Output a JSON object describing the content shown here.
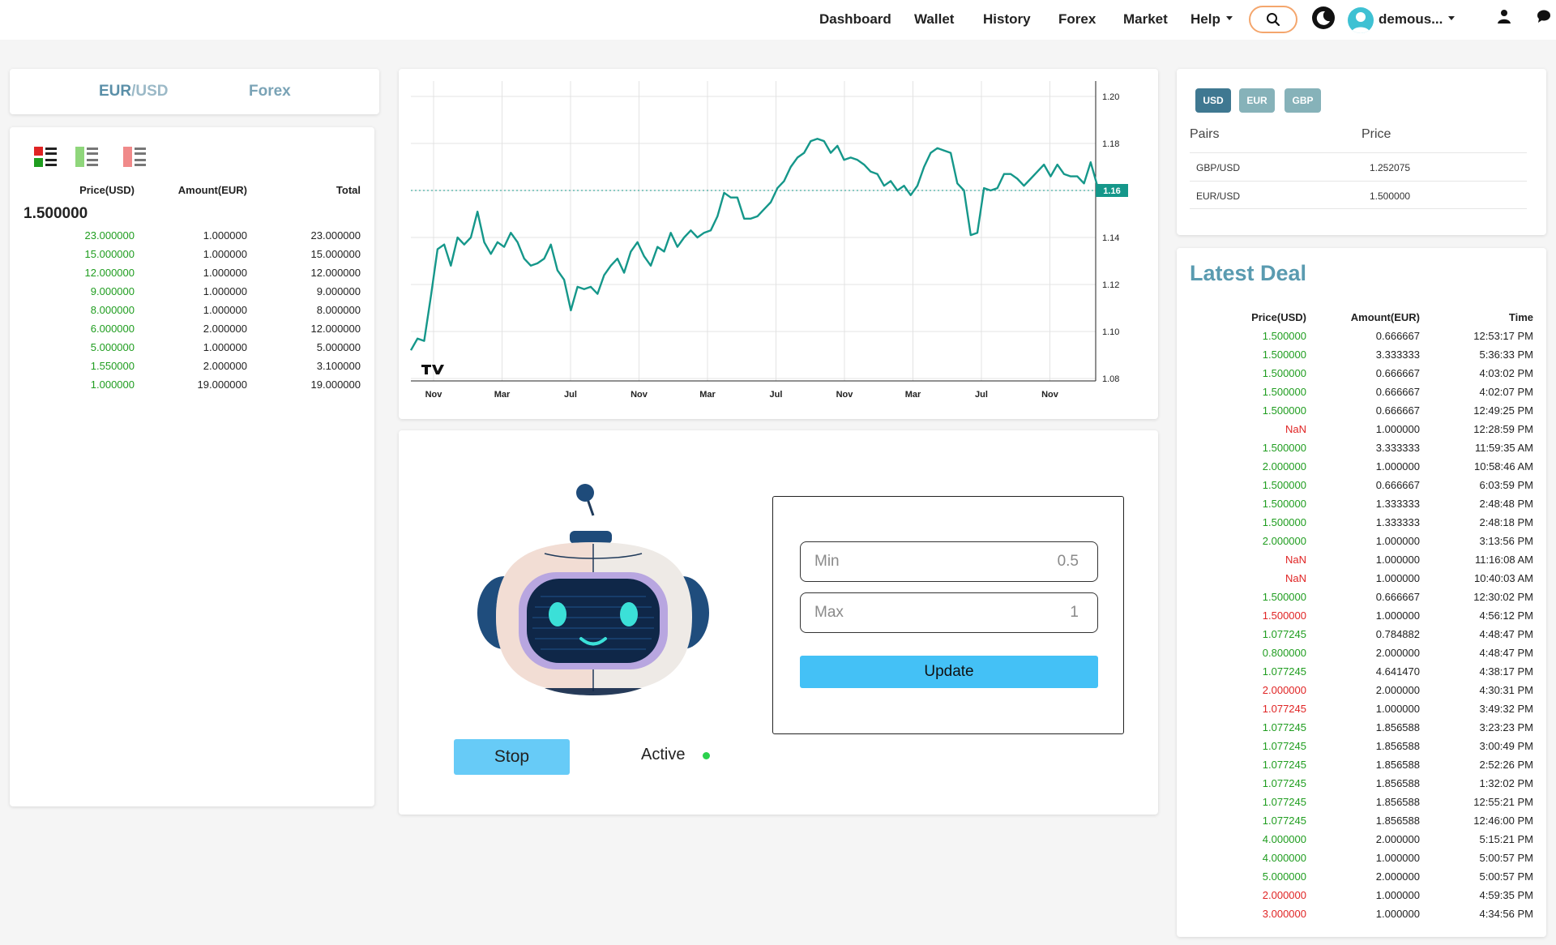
{
  "nav": {
    "links": [
      "Dashboard",
      "Wallet",
      "History",
      "Forex",
      "Market"
    ],
    "help": "Help",
    "username": "demous..."
  },
  "pair_tabs": {
    "pair_base": "EUR",
    "pair_sep": "/",
    "pair_quote": "USD",
    "market": "Forex"
  },
  "orderbook": {
    "headers": {
      "price": "Price(USD)",
      "amount": "Amount(EUR)",
      "total": "Total"
    },
    "last_price": "1.500000",
    "rows": [
      {
        "price": "23.000000",
        "amount": "1.000000",
        "total": "23.000000"
      },
      {
        "price": "15.000000",
        "amount": "1.000000",
        "total": "15.000000"
      },
      {
        "price": "12.000000",
        "amount": "1.000000",
        "total": "12.000000"
      },
      {
        "price": "9.000000",
        "amount": "1.000000",
        "total": "9.000000"
      },
      {
        "price": "8.000000",
        "amount": "1.000000",
        "total": "8.000000"
      },
      {
        "price": "6.000000",
        "amount": "2.000000",
        "total": "12.000000"
      },
      {
        "price": "5.000000",
        "amount": "1.000000",
        "total": "5.000000"
      },
      {
        "price": "1.550000",
        "amount": "2.000000",
        "total": "3.100000"
      },
      {
        "price": "1.000000",
        "amount": "19.000000",
        "total": "19.000000"
      }
    ]
  },
  "chart_data": {
    "type": "line",
    "x_ticks": [
      "Nov",
      "Mar",
      "Jul",
      "Nov",
      "Mar",
      "Jul",
      "Nov",
      "Mar",
      "Jul",
      "Nov"
    ],
    "y_ticks": [
      "1.20",
      "1.18",
      "1.16",
      "1.14",
      "1.12",
      "1.10",
      "1.08"
    ],
    "ylim": [
      1.08,
      1.2
    ],
    "current_value": 1.16,
    "current_label": "1.16",
    "line_color": "#15978a",
    "series": [
      {
        "values": [
          1.092,
          1.097,
          1.096,
          1.115,
          1.135,
          1.137,
          1.128,
          1.14,
          1.137,
          1.14,
          1.151,
          1.138,
          1.133,
          1.138,
          1.136,
          1.142,
          1.138,
          1.131,
          1.128,
          1.129,
          1.131,
          1.137,
          1.126,
          1.122,
          1.109,
          1.119,
          1.118,
          1.119,
          1.116,
          1.124,
          1.128,
          1.131,
          1.125,
          1.134,
          1.138,
          1.132,
          1.128,
          1.136,
          1.134,
          1.142,
          1.136,
          1.14,
          1.143,
          1.14,
          1.142,
          1.143,
          1.149,
          1.159,
          1.157,
          1.157,
          1.148,
          1.148,
          1.149,
          1.152,
          1.155,
          1.161,
          1.164,
          1.17,
          1.174,
          1.176,
          1.181,
          1.182,
          1.181,
          1.176,
          1.179,
          1.173,
          1.174,
          1.173,
          1.171,
          1.168,
          1.167,
          1.162,
          1.164,
          1.16,
          1.162,
          1.158,
          1.162,
          1.17,
          1.176,
          1.178,
          1.177,
          1.176,
          1.163,
          1.16,
          1.141,
          1.142,
          1.161,
          1.16,
          1.161,
          1.167,
          1.167,
          1.165,
          1.162,
          1.165,
          1.168,
          1.171,
          1.166,
          1.171,
          1.167,
          1.166,
          1.166,
          1.163,
          1.172,
          1.162
        ]
      }
    ]
  },
  "bot": {
    "stop_label": "Stop",
    "status_label": "Active",
    "min_label": "Min",
    "min_value": "0.5",
    "max_label": "Max",
    "max_value": "1",
    "update_label": "Update"
  },
  "prices": {
    "currencies": [
      "USD",
      "EUR",
      "GBP"
    ],
    "headers": {
      "pairs": "Pairs",
      "price": "Price"
    },
    "rows": [
      {
        "pair": "GBP/USD",
        "price": "1.252075"
      },
      {
        "pair": "EUR/USD",
        "price": "1.500000"
      }
    ]
  },
  "latest_deal": {
    "title": "Latest Deal",
    "headers": {
      "price": "Price(USD)",
      "amount": "Amount(EUR)",
      "time": "Time"
    },
    "rows": [
      {
        "price": "1.500000",
        "amount": "0.666667",
        "time": "12:53:17 PM",
        "dir": "up"
      },
      {
        "price": "1.500000",
        "amount": "3.333333",
        "time": "5:36:33 PM",
        "dir": "up"
      },
      {
        "price": "1.500000",
        "amount": "0.666667",
        "time": "4:03:02 PM",
        "dir": "up"
      },
      {
        "price": "1.500000",
        "amount": "0.666667",
        "time": "4:02:07 PM",
        "dir": "up"
      },
      {
        "price": "1.500000",
        "amount": "0.666667",
        "time": "12:49:25 PM",
        "dir": "up"
      },
      {
        "price": "NaN",
        "amount": "1.000000",
        "time": "12:28:59 PM",
        "dir": "down"
      },
      {
        "price": "1.500000",
        "amount": "3.333333",
        "time": "11:59:35 AM",
        "dir": "up"
      },
      {
        "price": "2.000000",
        "amount": "1.000000",
        "time": "10:58:46 AM",
        "dir": "up"
      },
      {
        "price": "1.500000",
        "amount": "0.666667",
        "time": "6:03:59 PM",
        "dir": "up"
      },
      {
        "price": "1.500000",
        "amount": "1.333333",
        "time": "2:48:48 PM",
        "dir": "up"
      },
      {
        "price": "1.500000",
        "amount": "1.333333",
        "time": "2:48:18 PM",
        "dir": "up"
      },
      {
        "price": "2.000000",
        "amount": "1.000000",
        "time": "3:13:56 PM",
        "dir": "up"
      },
      {
        "price": "NaN",
        "amount": "1.000000",
        "time": "11:16:08 AM",
        "dir": "down"
      },
      {
        "price": "NaN",
        "amount": "1.000000",
        "time": "10:40:03 AM",
        "dir": "down"
      },
      {
        "price": "1.500000",
        "amount": "0.666667",
        "time": "12:30:02 PM",
        "dir": "up"
      },
      {
        "price": "1.500000",
        "amount": "1.000000",
        "time": "4:56:12 PM",
        "dir": "down"
      },
      {
        "price": "1.077245",
        "amount": "0.784882",
        "time": "4:48:47 PM",
        "dir": "up"
      },
      {
        "price": "0.800000",
        "amount": "2.000000",
        "time": "4:48:47 PM",
        "dir": "up"
      },
      {
        "price": "1.077245",
        "amount": "4.641470",
        "time": "4:38:17 PM",
        "dir": "up"
      },
      {
        "price": "2.000000",
        "amount": "2.000000",
        "time": "4:30:31 PM",
        "dir": "down"
      },
      {
        "price": "1.077245",
        "amount": "1.000000",
        "time": "3:49:32 PM",
        "dir": "down"
      },
      {
        "price": "1.077245",
        "amount": "1.856588",
        "time": "3:23:23 PM",
        "dir": "up"
      },
      {
        "price": "1.077245",
        "amount": "1.856588",
        "time": "3:00:49 PM",
        "dir": "up"
      },
      {
        "price": "1.077245",
        "amount": "1.856588",
        "time": "2:52:26 PM",
        "dir": "up"
      },
      {
        "price": "1.077245",
        "amount": "1.856588",
        "time": "1:32:02 PM",
        "dir": "up"
      },
      {
        "price": "1.077245",
        "amount": "1.856588",
        "time": "12:55:21 PM",
        "dir": "up"
      },
      {
        "price": "1.077245",
        "amount": "1.856588",
        "time": "12:46:00 PM",
        "dir": "up"
      },
      {
        "price": "4.000000",
        "amount": "2.000000",
        "time": "5:15:21 PM",
        "dir": "up"
      },
      {
        "price": "4.000000",
        "amount": "1.000000",
        "time": "5:00:57 PM",
        "dir": "up"
      },
      {
        "price": "5.000000",
        "amount": "2.000000",
        "time": "5:00:57 PM",
        "dir": "up"
      },
      {
        "price": "2.000000",
        "amount": "1.000000",
        "time": "4:59:35 PM",
        "dir": "down"
      },
      {
        "price": "3.000000",
        "amount": "1.000000",
        "time": "4:34:56 PM",
        "dir": "down"
      }
    ]
  },
  "colors": {
    "accent": "#44c1f6",
    "up": "#1f9d1f",
    "down": "#e02424",
    "tab_active": "#5a8fa8",
    "chart_line": "#15978a"
  }
}
